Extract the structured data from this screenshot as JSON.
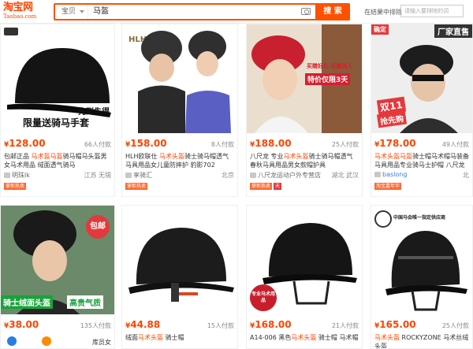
{
  "header": {
    "logo_cn": "淘宝网",
    "logo_en": "Taobao.com",
    "search_scope": "宝贝",
    "search_query": "马盔",
    "search_button": "搜 索",
    "within_label": "在结果中排除",
    "within_placeholder": "请输入要排除的词"
  },
  "accent_color": "#ff5000",
  "price_color": "#ff4400",
  "products": [
    {
      "price": "128.00",
      "paid": "66人付款",
      "title_pre": "包邮正品 ",
      "title_hl": "马术盔马盔",
      "title_post": "骑马帽马头盔男女马术用品 绒面透气骑马",
      "shop": "明珠lk",
      "location": "江苏 无锡",
      "badges": [
        "掌柜热卖"
      ],
      "img_text_1": "先到先得",
      "img_text_2": "限量送骑马手套"
    },
    {
      "price": "158.00",
      "paid": "8人付款",
      "title_pre": "HLH欧联仕 ",
      "title_hl": "马术头盔",
      "title_post": "骑士骑马帽透气马具用品女儿童防摔护 豹影702",
      "shop": "享骑汇",
      "location": "北京",
      "badges": [
        "掌柜热卖"
      ],
      "img_text_1": "HLH",
      "img_text_2": ""
    },
    {
      "price": "188.00",
      "paid": "25人付款",
      "title_pre": "八尺龙 专业",
      "title_hl": "马术头盔",
      "title_post": "骑士骑马帽透气春秋马具用品男女款帽护具",
      "shop": "八尺龙运动户外专营店",
      "location": "湖北 武汉",
      "badges": [
        "掌柜热卖",
        "天"
      ],
      "img_text_1": "买赠好礼 优惠送人",
      "img_text_2": "特价仅限3天"
    },
    {
      "price": "178.00",
      "paid": "49人付款",
      "title_pre": "",
      "title_hl": "马术头盔马盔",
      "title_post": "骑士帽马术帽马装备马具用品专业骑马士护帽 八尺龙正品",
      "shop": "baslong",
      "location": "北",
      "badges": [
        "淘宝嘉年华"
      ],
      "img_text_1": "双11",
      "img_text_2": "抢先购",
      "img_text_3": "厂家直售",
      "corner_tag": "确定"
    },
    {
      "price": "38.00",
      "paid": "135人付款",
      "title_pre": "",
      "title_hl": "",
      "title_post": "",
      "shop": "",
      "location": "库员女",
      "badges": [],
      "img_text_1": "包邮",
      "img_text_2": "骑士绒面头盔",
      "img_text_3": "高贵气质"
    },
    {
      "price": "44.88",
      "paid": "15人付款",
      "title_pre": "绒面",
      "title_hl": "马术头盔",
      "title_post": " 骑士帽",
      "shop": "",
      "location": "",
      "badges": [],
      "img_text_1": ""
    },
    {
      "price": "168.00",
      "paid": "21人付款",
      "title_pre": "A14-006 黑色",
      "title_hl": "马术头盔",
      "title_post": " 骑士帽 马术帽",
      "shop": "",
      "location": "",
      "badges": [],
      "img_text_1": "专业马术用品"
    },
    {
      "price": "165.00",
      "paid": "25人付款",
      "title_pre": "",
      "title_hl": "马术头盔",
      "title_post": " ROCKYZONE 马术丝绒头盔",
      "shop": "",
      "location": "",
      "badges": [],
      "img_text_1": "中国马会唯一指定供应商"
    }
  ]
}
